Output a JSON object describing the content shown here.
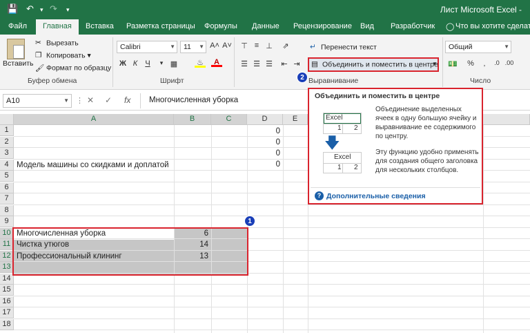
{
  "title_bar": {
    "document_title": "Лист Microsoft Excel -"
  },
  "tabs": [
    {
      "label": "Файл"
    },
    {
      "label": "Главная"
    },
    {
      "label": "Вставка"
    },
    {
      "label": "Разметка страницы"
    },
    {
      "label": "Формулы"
    },
    {
      "label": "Данные"
    },
    {
      "label": "Рецензирование"
    },
    {
      "label": "Вид"
    },
    {
      "label": "Разработчик"
    }
  ],
  "tell_me": "Что вы хотите сделать?",
  "ribbon": {
    "clipboard": {
      "paste": "Вставить",
      "cut": "Вырезать",
      "copy": "Копировать",
      "format_painter": "Формат по образцу",
      "group_label": "Буфер обмена"
    },
    "font": {
      "name": "Calibri",
      "size": "11",
      "bold": "Ж",
      "italic": "К",
      "underline": "Ч",
      "group_label": "Шрифт"
    },
    "alignment": {
      "wrap_text": "Перенести текст",
      "merge_center": "Объединить и поместить в центре",
      "group_label": "Выравнивание"
    },
    "number": {
      "format": "Общий",
      "group_label": "Число"
    }
  },
  "formula_bar": {
    "name_box": "A10",
    "value": "Многочисленная уборка"
  },
  "columns": [
    "A",
    "B",
    "C",
    "D",
    "E"
  ],
  "rows": [
    "1",
    "2",
    "3",
    "4",
    "5",
    "6",
    "7",
    "8",
    "9",
    "10",
    "11",
    "12",
    "13",
    "14",
    "15",
    "16",
    "17",
    "18"
  ],
  "cells": {
    "A4": "Модель машины со скидками и доплатой",
    "D1": "0",
    "D2": "0",
    "D3": "0",
    "D4": "0",
    "A10": "Многочисленная уборка",
    "B10": "6",
    "A11": "Чистка утюгов",
    "B11": "14",
    "A12": "Профессиональный клининг",
    "B12": "13"
  },
  "badges": {
    "one": "1",
    "two": "2"
  },
  "tooltip": {
    "title": "Объединить и поместить в центре",
    "para1": "Объединение выделенных ячеек в одну большую ячейку и выравнивание ее содержимого по центру.",
    "para2": "Эту функцию удобно применять для создания общего заголовка для нескольких столбцов.",
    "more": "Дополнительные сведения",
    "sample_word": "Excel",
    "sample_n1": "1",
    "sample_n2": "2"
  },
  "colors": {
    "excel_green": "#217346",
    "highlight_red": "#d9232d",
    "badge_blue": "#1a3fb8"
  }
}
